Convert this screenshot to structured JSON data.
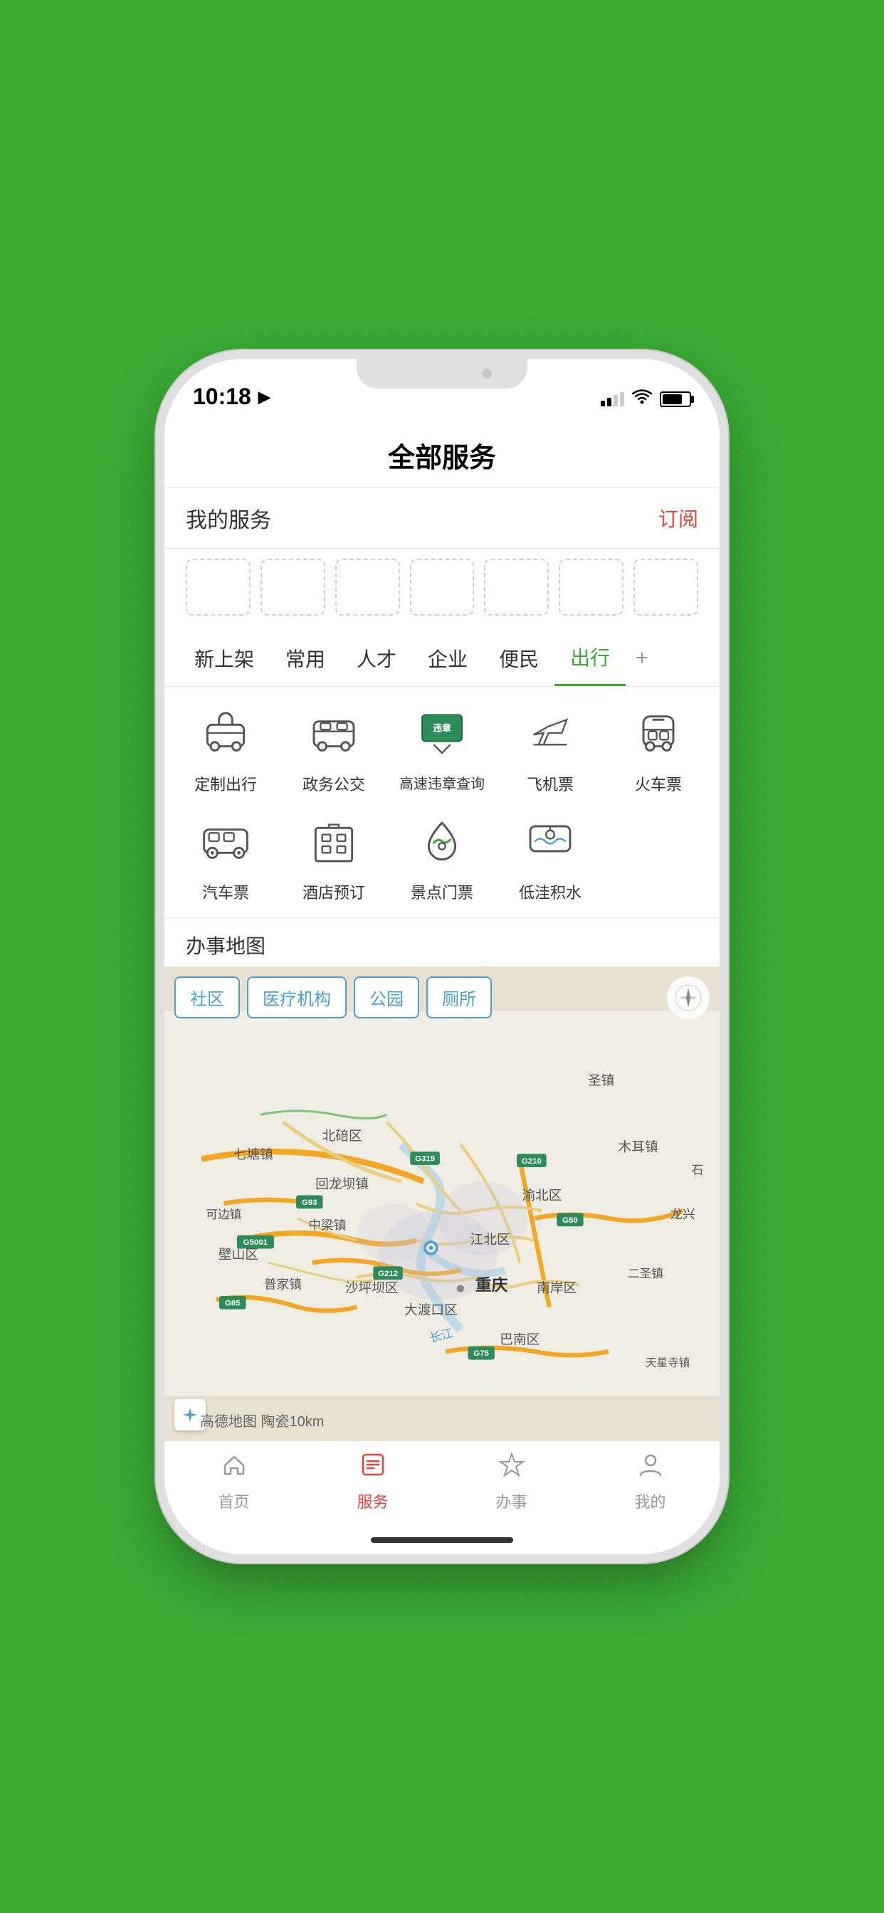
{
  "status_bar": {
    "time": "10:18",
    "location_arrow": "▶"
  },
  "header": {
    "title": "全部服务"
  },
  "my_services": {
    "label": "我的服务",
    "subscribe": "订阅"
  },
  "category_tabs": {
    "items": [
      {
        "label": "新上架",
        "active": false
      },
      {
        "label": "常用",
        "active": false
      },
      {
        "label": "人才",
        "active": false
      },
      {
        "label": "企业",
        "active": false
      },
      {
        "label": "便民",
        "active": false
      },
      {
        "label": "出行",
        "active": true
      }
    ],
    "add_label": "+"
  },
  "services_row1": [
    {
      "label": "定制出行",
      "icon": "custom-trip"
    },
    {
      "label": "政务公交",
      "icon": "gov-bus"
    },
    {
      "label": "高速违章查询",
      "icon": "highway-violation"
    },
    {
      "label": "飞机票",
      "icon": "airplane"
    },
    {
      "label": "火车票",
      "icon": "train"
    }
  ],
  "services_row2": [
    {
      "label": "汽车票",
      "icon": "bus-ticket"
    },
    {
      "label": "酒店预订",
      "icon": "hotel"
    },
    {
      "label": "景点门票",
      "icon": "attraction"
    },
    {
      "label": "低洼积水",
      "icon": "flood"
    }
  ],
  "map_section": {
    "title": "办事地图",
    "tabs": [
      "社区",
      "医疗机构",
      "公园",
      "厕所"
    ],
    "location": "重庆",
    "watermark": "高德地图 陶瓷10km",
    "place_labels": [
      "圣镇",
      "木耳镇",
      "北碚区",
      "回龙坝镇",
      "七塘镇",
      "渝北区",
      "可边镇",
      "壁山区",
      "中梁镇",
      "江北区",
      "普家镇",
      "沙坪坝区",
      "大渡口区",
      "南岸区",
      "二圣镇",
      "巴南区",
      "天星寺镇",
      "龙兴",
      "石"
    ],
    "road_labels": [
      "G319",
      "G93",
      "G5001",
      "G212",
      "G210",
      "G50",
      "G85",
      "G75",
      "长江"
    ]
  },
  "bottom_nav": {
    "items": [
      {
        "label": "首页",
        "icon": "home",
        "active": false
      },
      {
        "label": "服务",
        "icon": "services",
        "active": true
      },
      {
        "label": "办事",
        "icon": "tasks",
        "active": false
      },
      {
        "label": "我的",
        "icon": "profile",
        "active": false
      }
    ]
  }
}
